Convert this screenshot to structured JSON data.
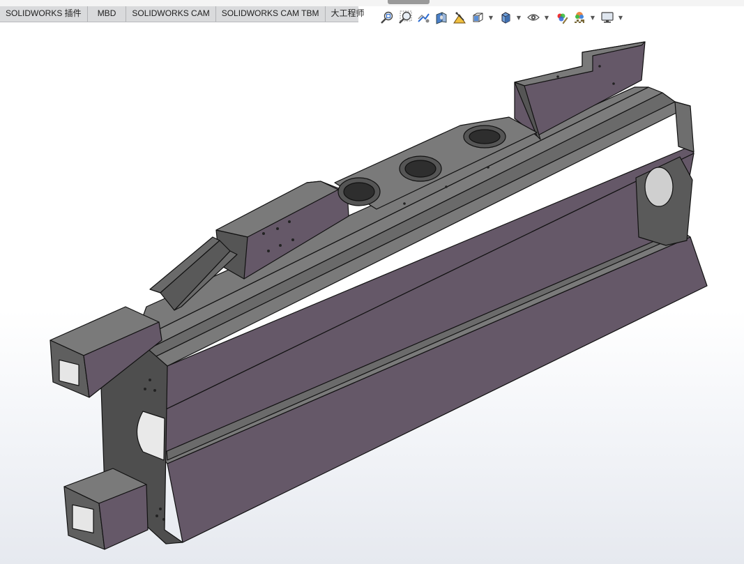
{
  "ribbon_tabs": [
    {
      "label": "SOLIDWORKS 插件"
    },
    {
      "label": "MBD"
    },
    {
      "label": "SOLIDWORKS CAM"
    },
    {
      "label": "SOLIDWORKS CAM TBM"
    },
    {
      "label": "大工程师"
    }
  ],
  "heads_up_toolbar": [
    {
      "icon": "zoom-to-fit-icon"
    },
    {
      "icon": "zoom-to-area-icon"
    },
    {
      "icon": "previous-view-icon"
    },
    {
      "icon": "section-view-icon"
    },
    {
      "icon": "dynamic-annotation-view-icon"
    },
    {
      "icon": "view-orientation-icon",
      "has_dropdown": true
    },
    {
      "icon": "display-style-icon",
      "has_dropdown": true
    },
    {
      "icon": "hide-show-items-icon",
      "has_dropdown": true
    },
    {
      "icon": "edit-appearance-icon"
    },
    {
      "icon": "apply-scene-icon",
      "has_dropdown": true
    },
    {
      "icon": "view-settings-icon",
      "has_dropdown": true
    }
  ],
  "colors": {
    "part_face_side": "#655868",
    "part_face_top": "#7a7a7a",
    "part_face_dark": "#4e4e4e",
    "edge": "#111111"
  }
}
